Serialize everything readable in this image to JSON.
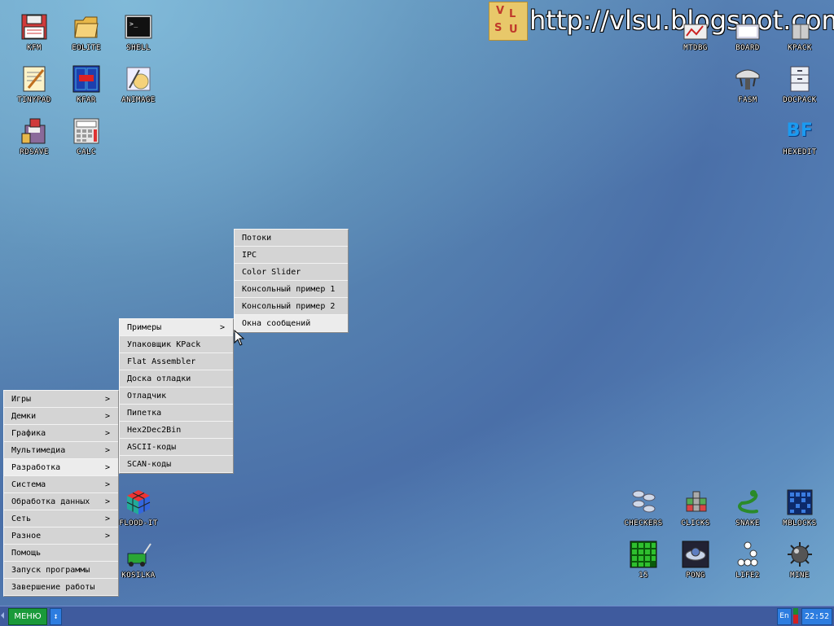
{
  "watermark": {
    "text": "http://vlsu.blogspot.com",
    "logo_letters": [
      "V",
      "L",
      "S",
      "U"
    ]
  },
  "desktop_icons": {
    "kfm": "KFM",
    "eolite": "EOLITE",
    "shell": "SHELL",
    "tinypad": "TINYPAD",
    "kfar": "KFAR",
    "animage": "ANIMAGE",
    "rdsave": "RDSAVE",
    "calc": "CALC",
    "mtdbg": "MTDBG",
    "board": "BOARD",
    "kpack": "KPACK",
    "fasm": "FASM",
    "docpack": "DOCPACK",
    "hexedit": "HEXEDIT",
    "floodit": "FLOOD-IT",
    "kosilka": "KOSILKA",
    "checkers": "CHECKERS",
    "clicks": "CLICKS",
    "snake": "SNAKE",
    "mblocks": "MBLOCKS",
    "fifteen": "15",
    "pong": "PONG",
    "life2": "LIFE2",
    "mine": "MINE",
    "hexedit_glyph": "BF"
  },
  "main_menu": [
    {
      "label": "Игры",
      "arrow": ">"
    },
    {
      "label": "Демки",
      "arrow": ">"
    },
    {
      "label": "Графика",
      "arrow": ">"
    },
    {
      "label": "Мультимедиа",
      "arrow": ">"
    },
    {
      "label": "Разработка",
      "arrow": ">"
    },
    {
      "label": "Система",
      "arrow": ">"
    },
    {
      "label": "Обработка данных",
      "arrow": ">"
    },
    {
      "label": "Сеть",
      "arrow": ">"
    },
    {
      "label": "Разное",
      "arrow": ">"
    },
    {
      "label": "Помощь",
      "arrow": ""
    },
    {
      "label": "Запуск программы",
      "arrow": ""
    },
    {
      "label": "Завершение работы",
      "arrow": ""
    }
  ],
  "dev_menu": [
    {
      "label": "Примеры",
      "arrow": ">"
    },
    {
      "label": "Упаковщик KPack",
      "arrow": ""
    },
    {
      "label": "Flat Assembler",
      "arrow": ""
    },
    {
      "label": "Доска отладки",
      "arrow": ""
    },
    {
      "label": "Отладчик",
      "arrow": ""
    },
    {
      "label": "Пипетка",
      "arrow": ""
    },
    {
      "label": "Hex2Dec2Bin",
      "arrow": ""
    },
    {
      "label": "ASCII-коды",
      "arrow": ""
    },
    {
      "label": "SCAN-коды",
      "arrow": ""
    }
  ],
  "examples_menu": [
    {
      "label": "Потоки"
    },
    {
      "label": "IPC"
    },
    {
      "label": "Color Slider"
    },
    {
      "label": "Консольный пример 1"
    },
    {
      "label": "Консольный пример 2"
    },
    {
      "label": "Окна сообщений"
    }
  ],
  "taskbar": {
    "menu_label": "МЕНЮ",
    "switch_glyph": "↕",
    "lang": "En",
    "clock": "22:52"
  },
  "colors": {
    "taskbar": "#3f5b9e",
    "menu_button": "#1a9a3a",
    "accent_blue": "#2d7de0",
    "menu_bg": "#d6d6d6"
  }
}
